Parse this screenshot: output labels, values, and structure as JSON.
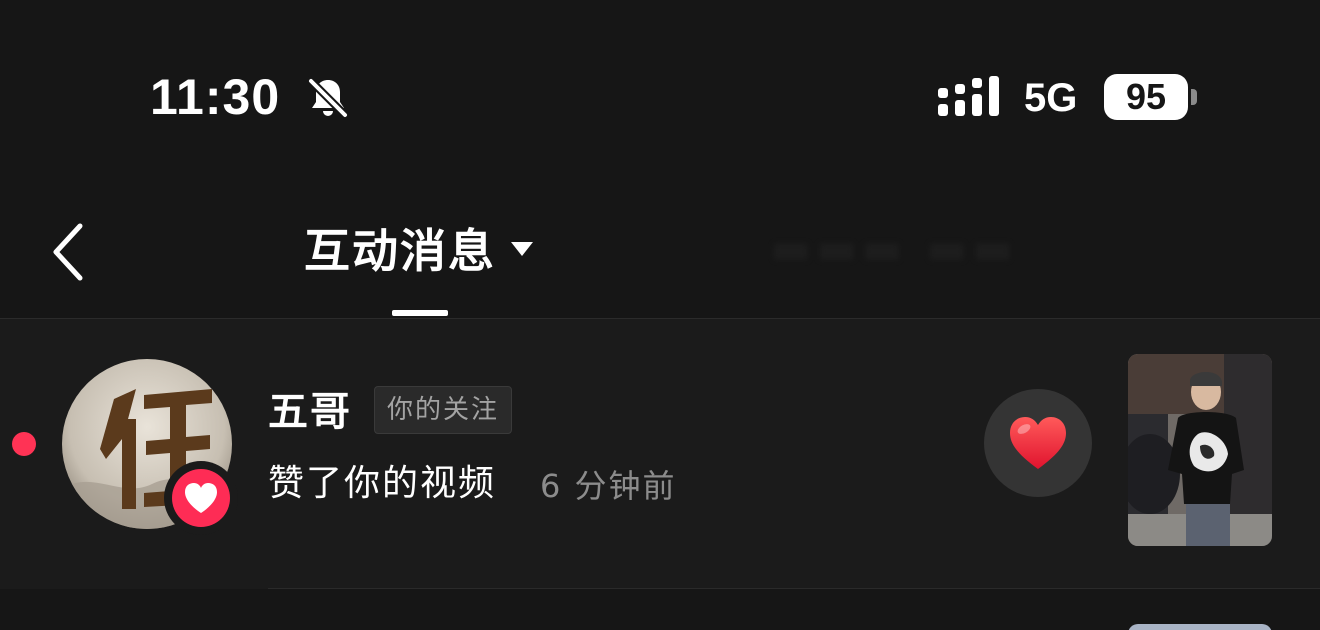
{
  "status_bar": {
    "time": "11:30",
    "network": "5G",
    "battery_level": "95",
    "icons": [
      "bell-slash-icon",
      "signal-bars-icon"
    ]
  },
  "nav": {
    "back_icon": "chevron-left-icon",
    "title": "互动消息",
    "title_caret_icon": "caret-down-icon"
  },
  "notifications": [
    {
      "username": "五哥",
      "relation_tag": "你的关注",
      "action": "赞了你的视频",
      "time_ago": "6 分钟前",
      "unread": true,
      "badge_icon": "heart-icon",
      "action_icon": "red-heart-icon",
      "colors": {
        "accent": "#fe2c55",
        "unread_dot": "#ff3355"
      }
    }
  ]
}
